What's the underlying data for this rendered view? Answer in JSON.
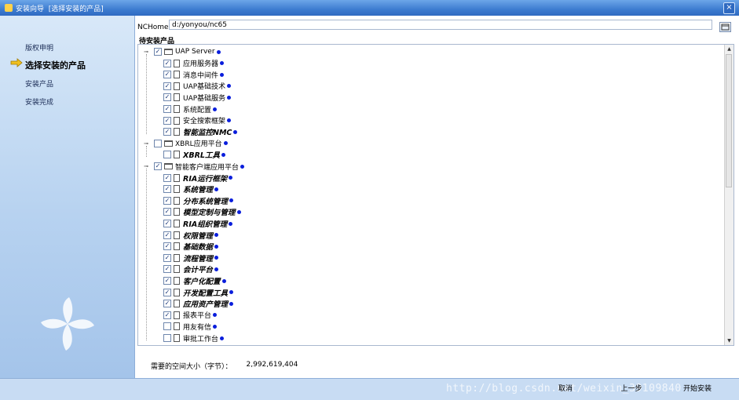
{
  "window": {
    "title": "安装向导  [选择安装的产品]",
    "close_label": "×"
  },
  "sidebar": {
    "steps": [
      {
        "label": "版权申明",
        "current": false
      },
      {
        "label": "选择安装的产品",
        "current": true
      },
      {
        "label": "安装产品",
        "current": false
      },
      {
        "label": "安装完成",
        "current": false
      }
    ]
  },
  "path": {
    "label": "NCHome目录：",
    "value": "d:/yonyou/nc65"
  },
  "tree": {
    "section_label": "待安装产品",
    "nodes": [
      {
        "label": "UAP Server",
        "level": 0,
        "checked": true,
        "style": "normal"
      },
      {
        "label": "应用服务器",
        "level": 1,
        "checked": true,
        "style": "normal"
      },
      {
        "label": "消息中间件",
        "level": 1,
        "checked": true,
        "style": "normal"
      },
      {
        "label": "UAP基础技术",
        "level": 1,
        "checked": true,
        "style": "normal"
      },
      {
        "label": "UAP基础服务",
        "level": 1,
        "checked": true,
        "style": "normal"
      },
      {
        "label": "系统配置",
        "level": 1,
        "checked": true,
        "style": "normal"
      },
      {
        "label": "安全搜索框架",
        "level": 1,
        "checked": true,
        "style": "normal"
      },
      {
        "label": "智能监控NMC",
        "level": 1,
        "checked": true,
        "style": "italic-bold"
      },
      {
        "label": "XBRL应用平台",
        "level": 0,
        "checked": false,
        "style": "normal"
      },
      {
        "label": "XBRL工具",
        "level": 1,
        "checked": false,
        "style": "italic-bold"
      },
      {
        "label": "智能客户端应用平台",
        "level": 0,
        "checked": true,
        "style": "normal"
      },
      {
        "label": "RIA运行框架",
        "level": 1,
        "checked": true,
        "style": "italic-bold"
      },
      {
        "label": "系统管理",
        "level": 1,
        "checked": true,
        "style": "italic-bold"
      },
      {
        "label": "分布系统管理",
        "level": 1,
        "checked": true,
        "style": "italic-bold"
      },
      {
        "label": "模型定制与管理",
        "level": 1,
        "checked": true,
        "style": "italic-bold"
      },
      {
        "label": "RIA组织管理",
        "level": 1,
        "checked": true,
        "style": "italic-bold"
      },
      {
        "label": "权限管理",
        "level": 1,
        "checked": true,
        "style": "italic-bold"
      },
      {
        "label": "基础数据",
        "level": 1,
        "checked": true,
        "style": "italic-bold"
      },
      {
        "label": "流程管理",
        "level": 1,
        "checked": true,
        "style": "italic-bold"
      },
      {
        "label": "会计平台",
        "level": 1,
        "checked": true,
        "style": "italic-bold"
      },
      {
        "label": "客户化配置",
        "level": 1,
        "checked": true,
        "style": "italic-bold"
      },
      {
        "label": "开发配置工具",
        "level": 1,
        "checked": true,
        "style": "italic-bold"
      },
      {
        "label": "应用资产管理",
        "level": 1,
        "checked": true,
        "style": "italic-bold"
      },
      {
        "label": "报表平台",
        "level": 1,
        "checked": true,
        "style": "normal"
      },
      {
        "label": "用友有信",
        "level": 1,
        "checked": false,
        "style": "normal"
      },
      {
        "label": "审批工作台",
        "level": 1,
        "checked": false,
        "style": "normal"
      }
    ]
  },
  "space": {
    "label": "需要的空间大小（字节）：",
    "value": "2,992,619,404"
  },
  "footer": {
    "cancel_label": "取消",
    "prev_label": "上一步",
    "install_label": "开始安装",
    "watermark": "http://blog.csdn.net/weixin_39109840"
  },
  "colors": {
    "titlebar": "#3d7cd0",
    "dot": "#0a1edc",
    "arrow": "#f0c020"
  }
}
